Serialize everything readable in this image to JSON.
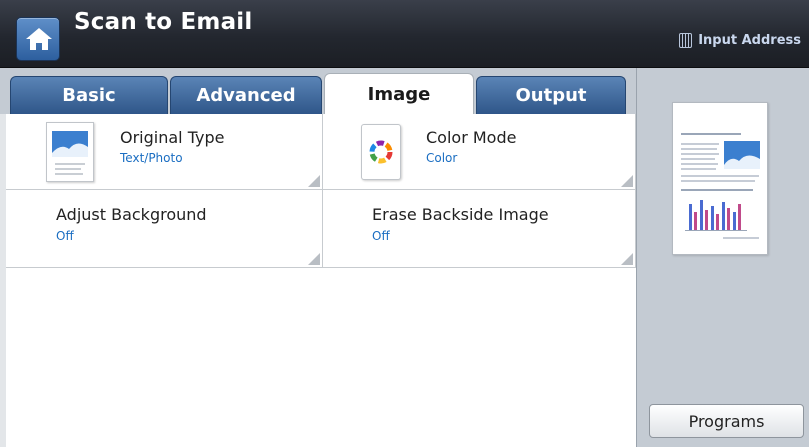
{
  "header": {
    "title": "Scan to Email",
    "input_address_label": "Input Address"
  },
  "tabs": [
    {
      "label": "Basic",
      "active": false
    },
    {
      "label": "Advanced",
      "active": false
    },
    {
      "label": "Image",
      "active": true
    },
    {
      "label": "Output",
      "active": false
    }
  ],
  "options": [
    {
      "label": "Original Type",
      "value": "Text/Photo",
      "icon": "original-type-icon"
    },
    {
      "label": "Color Mode",
      "value": "Color",
      "icon": "color-wheel-icon"
    },
    {
      "label": "Adjust Background",
      "value": "Off"
    },
    {
      "label": "Erase Backside Image",
      "value": "Off"
    }
  ],
  "sidebar": {
    "programs_label": "Programs"
  },
  "colors": {
    "accent_blue": "#1b6ec2",
    "tab_blue": "#2f5689",
    "header_dark": "#23272f"
  }
}
